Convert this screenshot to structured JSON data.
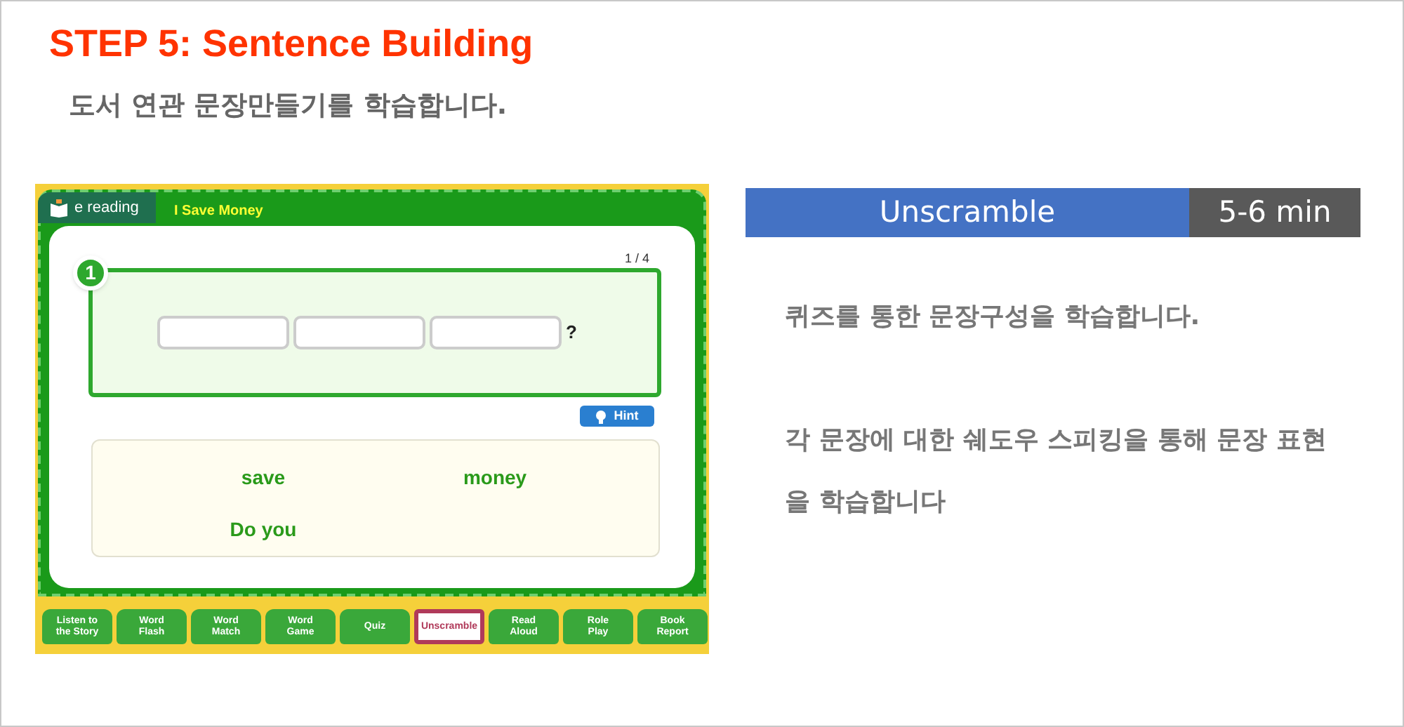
{
  "step_title": "STEP 5: Sentence Building",
  "step_subtitle": "도서 연관 문장만들기를 학습합니다.",
  "app": {
    "logo": "e reading",
    "book_title": "I Save Money",
    "question_number": "1",
    "progress": "1 / 4",
    "punctuation": "?",
    "hint_button": "Hint",
    "word_tiles": [
      "save",
      "money",
      "Do you"
    ],
    "tabs": [
      {
        "label": "Listen to\nthe Story",
        "selected": false
      },
      {
        "label": "Word\nFlash",
        "selected": false
      },
      {
        "label": "Word\nMatch",
        "selected": false
      },
      {
        "label": "Word\nGame",
        "selected": false
      },
      {
        "label": "Quiz",
        "selected": false
      },
      {
        "label": "Unscramble",
        "selected": true
      },
      {
        "label": "Read\nAloud",
        "selected": false
      },
      {
        "label": "Role\nPlay",
        "selected": false
      },
      {
        "label": "Book\nReport",
        "selected": false
      }
    ]
  },
  "activity": {
    "name": "Unscramble",
    "duration": "5-6 min"
  },
  "descriptions": [
    "퀴즈를 통한 문장구성을 학습합니다.",
    "각 문장에 대한 쉐도우 스피킹을 통해 문장 표현을 학습합니다"
  ]
}
